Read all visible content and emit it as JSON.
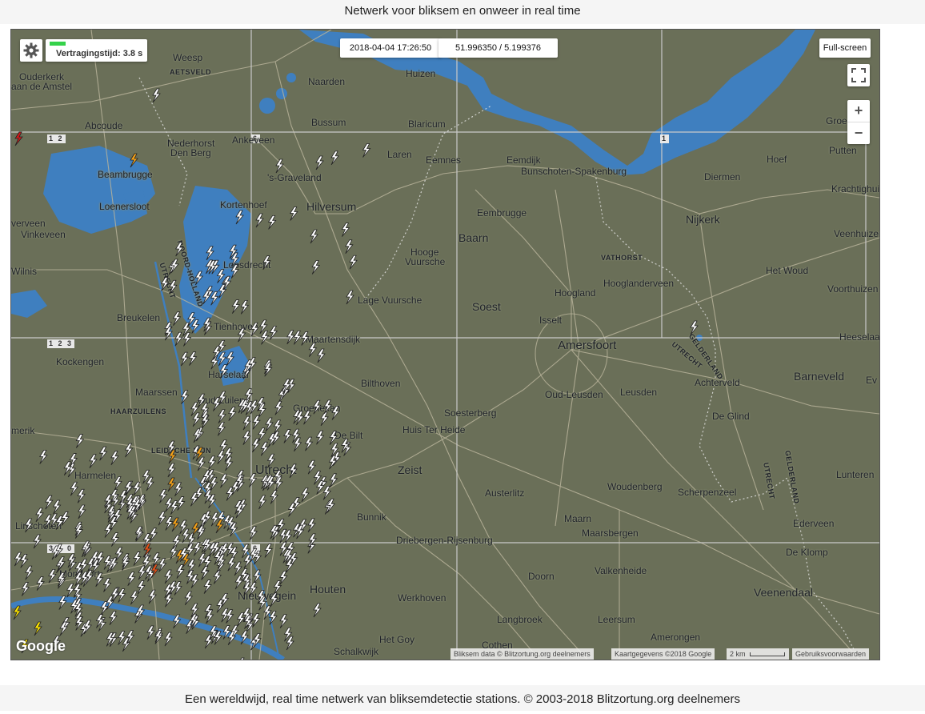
{
  "header": {
    "title": "Netwerk voor bliksem en onweer in real time"
  },
  "footer": {
    "text": "Een wereldwijd, real time netwerk van bliksemdetectie stations. © 2003-2018 Blitzortung.org deelnemers"
  },
  "controls": {
    "settings_icon": "gear-icon",
    "delay_label": "Vertragingstijd: 3.8 s",
    "timestamp": "2018-04-04 17:26:50",
    "coordinates": "51.996350 / 5.199376",
    "fullscreen_label": "Full-screen",
    "fullscreen_icon": "expand-icon",
    "zoom_in": "+",
    "zoom_out": "−"
  },
  "attribution": {
    "data": "Bliksem data © Blitzortung.org deelnemers",
    "map": "Kaartgegevens ©2018 Google",
    "scale": "2 km",
    "terms": "Gebruiksvoorwaarden",
    "logo": "Google"
  },
  "grid_cells": [
    "1 2",
    "6",
    "1",
    "1 2 3",
    "3 1 0",
    "6"
  ],
  "places": [
    "Weesp",
    "AETSVELD",
    "Naarden",
    "Huizen",
    "Ouderkerk",
    "aan de Amstel",
    "Abcoude",
    "Bussum",
    "Blaricum",
    "Nederhorst",
    "Den Berg",
    "Ankeveen",
    "Beambrugge",
    "'s-Graveland",
    "Laren",
    "Eemnes",
    "Eemdijk",
    "Bunschoten-Spakenburg",
    "Hoef",
    "Diermen",
    "Krachtighuis",
    "Putten",
    "Groen",
    "Loenersloot",
    "Kortenhoef",
    "Hilversum",
    "verveen",
    "Vinkeveen",
    "Eembrugge",
    "Baarn",
    "Nijkerk",
    "Veenhuizen",
    "Wilnis",
    "Loosdrecht",
    "Hooge",
    "Vuursche",
    "VATHORST",
    "Hooglanderveen",
    "Het Woud",
    "Voorthuizen",
    "Breukelen",
    "Lage Vuursche",
    "Soest",
    "Hoogland",
    "Tienhoven",
    "Maartensdijk",
    "Isselt",
    "Amersfoort",
    "Harselaar",
    "Bilthoven",
    "Kockengen",
    "Maarssen",
    "Oud Zuilen",
    "Oud-Leusden",
    "Leusden",
    "Achterveld",
    "Barneveld",
    "HAARZUILENS",
    "Groenekan",
    "Soesterberg",
    "De Glind",
    "LEIDSCHE RIJN",
    "De Bilt",
    "Huis Ter Heide",
    "Utrecht",
    "Zeist",
    "Harmelen",
    "Austerlitz",
    "Woudenberg",
    "Scherpenzeel",
    "Lunteren",
    "Linschoten",
    "Bunnik",
    "Maarn",
    "Maarsbergen",
    "Ederveen",
    "Driebergen-Rijsenburg",
    "De Klomp",
    "Montfoort",
    "Doorn",
    "Valkenheide",
    "Nieuwegein",
    "Houten",
    "Veenendaal",
    "Werkhoven",
    "Langbroek",
    "Leersum",
    "Het Goy",
    "Amerongen",
    "Schalkwijk",
    "Cothen",
    "Heeselaar",
    "GELDERLAND",
    "UTRECHT",
    "NOORD-HOLLAND",
    "merik",
    "Ev",
    "Voor"
  ],
  "legend_colors": {
    "recent": "#ffffff",
    "older": "#f4a21a",
    "oldest": "#e2531b",
    "newest": "#ffe600",
    "alert": "#d11a1a"
  }
}
